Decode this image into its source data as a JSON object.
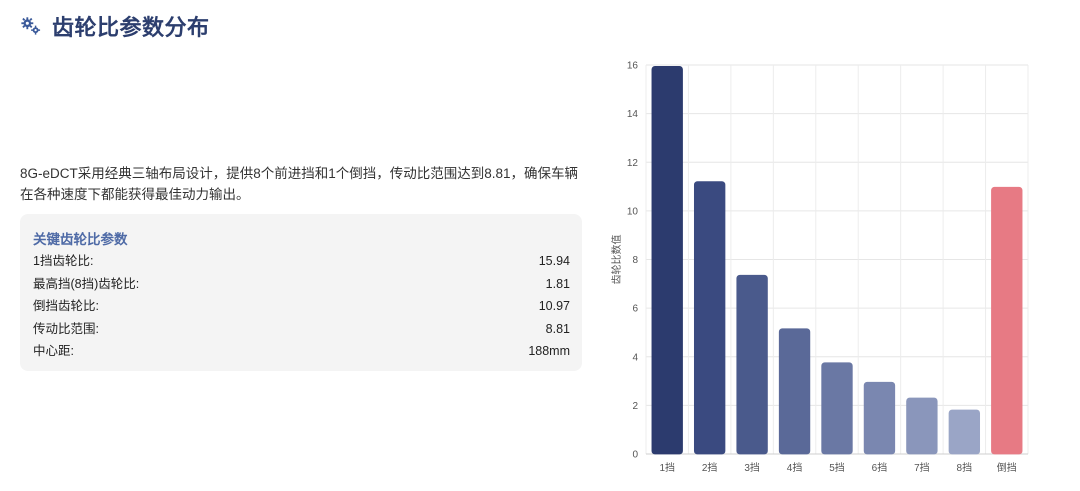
{
  "header": {
    "icon": "gears-icon",
    "title": "齿轮比参数分布",
    "color": "#2c3e6e"
  },
  "description": "8G-eDCT采用经典三轴布局设计，提供8个前进挡和1个倒挡，传动比范围达到8.81，确保车辆在各种速度下都能获得最佳动力输出。",
  "card": {
    "title": "关键齿轮比参数",
    "rows": [
      {
        "label": "1挡齿轮比:",
        "value": "15.94"
      },
      {
        "label": "最高挡(8挡)齿轮比:",
        "value": "1.81"
      },
      {
        "label": "倒挡齿轮比:",
        "value": "10.97"
      },
      {
        "label": "传动比范围:",
        "value": "8.81"
      },
      {
        "label": "中心距:",
        "value": "188mm"
      }
    ]
  },
  "chart_data": {
    "type": "bar",
    "title": "",
    "xlabel": "",
    "ylabel": "齿轮比数值",
    "ylim": [
      0,
      16
    ],
    "yticks": [
      0,
      2,
      4,
      6,
      8,
      10,
      12,
      14,
      16
    ],
    "grid": true,
    "categories": [
      "1挡",
      "2挡",
      "3挡",
      "4挡",
      "5挡",
      "6挡",
      "7挡",
      "8挡",
      "倒挡"
    ],
    "values": [
      15.94,
      11.2,
      7.35,
      5.15,
      3.75,
      2.95,
      2.3,
      1.81,
      10.97
    ],
    "colors": [
      "#2c3b6e",
      "#3a4a80",
      "#4a5a8c",
      "#5a6998",
      "#6a78a4",
      "#7a87b0",
      "#8a96bb",
      "#9aa5c6",
      "#e77a84"
    ]
  }
}
